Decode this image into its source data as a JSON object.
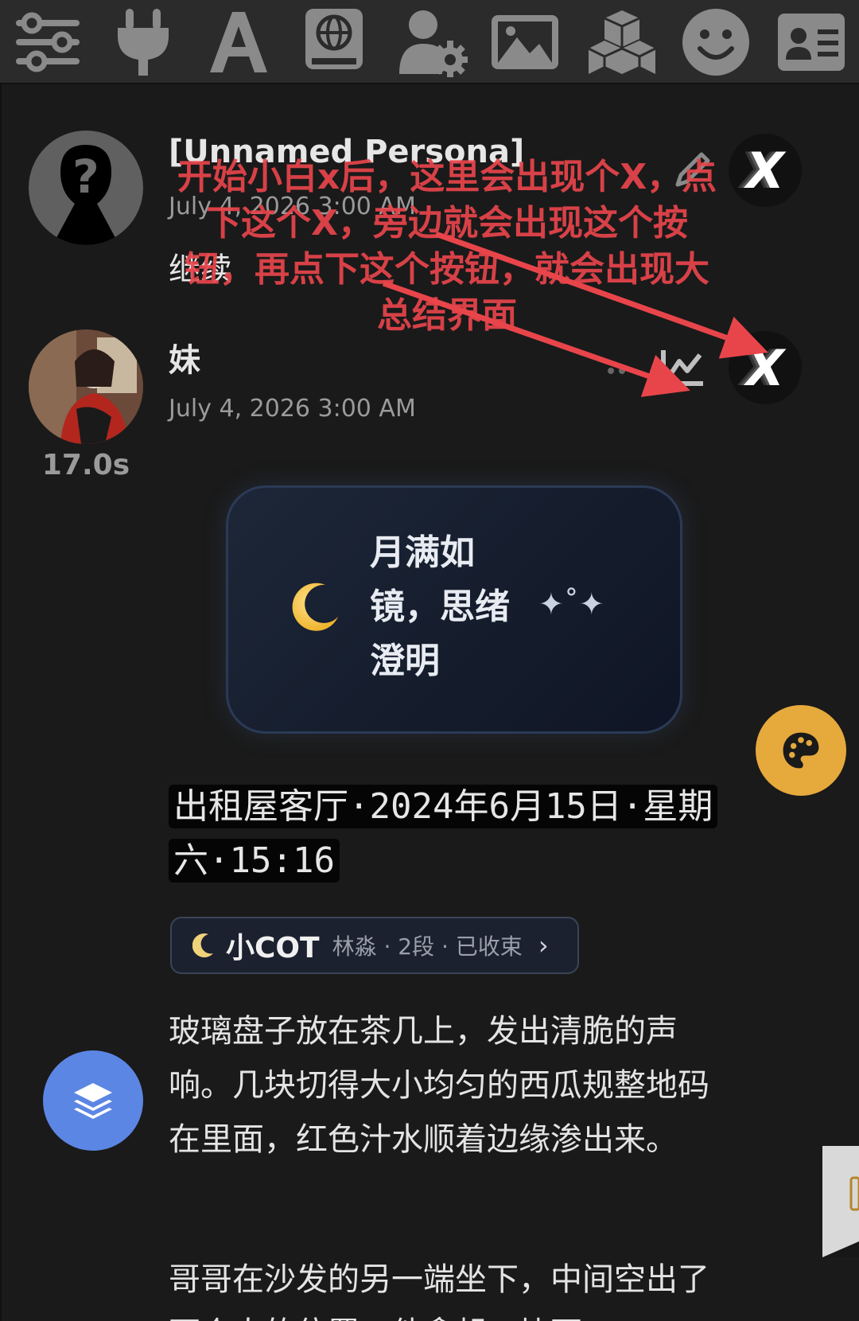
{
  "toolbar": {
    "icons": [
      "sliders-icon",
      "plug-icon",
      "font-icon",
      "book-globe-icon",
      "user-settings-icon",
      "image-icon",
      "cubes-icon",
      "smile-icon",
      "id-card-icon"
    ]
  },
  "messages": [
    {
      "name": "[Unnamed Persona]",
      "time": "July 4, 2026 3:00 AM",
      "text": "继续"
    },
    {
      "name": "妹",
      "time": "July 4, 2026 3:00 AM",
      "duration": "17.0s"
    }
  ],
  "annotation": {
    "text": "开始小白x后，这里会出现个X，点下这个X，旁边就会出现这个按钮，再点下这个按钮，就会出现大总结界面",
    "color": "#e8454b"
  },
  "moon_card": {
    "icon": "moon-icon",
    "text": "月满如镜，思绪澄明",
    "stars": "✦˚✦"
  },
  "scene": {
    "location": "出租屋客厅·2024年6月15日·星期六·15:16"
  },
  "cot": {
    "title": "小COT",
    "meta": "林淼 · 2段 · 已收束",
    "chevron": "›"
  },
  "paragraphs": [
    "玻璃盘子放在茶几上，发出清脆的声响。几块切得大小均匀的西瓜规整地码在里面，红色汁水顺着边缘渗出来。",
    "哥哥在沙发的另一端坐下，中间空出了两个人的位置。他拿起一块西"
  ],
  "colors": {
    "background": "#171717",
    "accent_palette": "#e6a93c",
    "accent_layers": "#5b86e4"
  }
}
